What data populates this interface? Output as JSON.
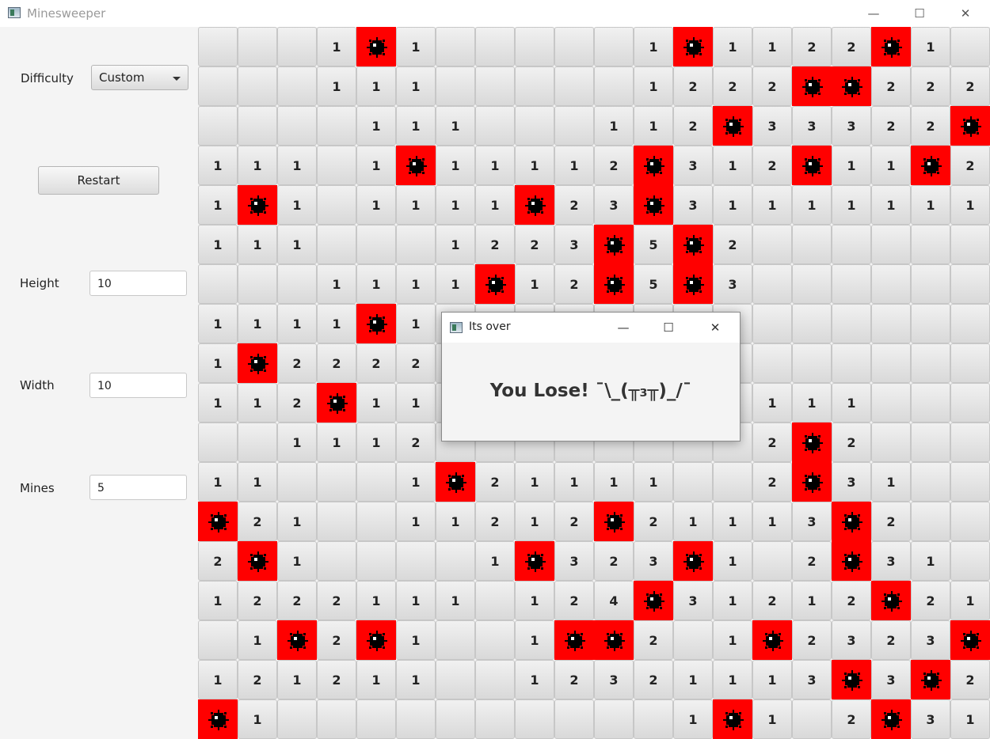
{
  "window": {
    "title": "Minesweeper",
    "minimize_icon": "minimize-icon",
    "maximize_icon": "maximize-icon",
    "close_icon": "close-icon",
    "minimize_glyph": "—",
    "maximize_glyph": "☐",
    "close_glyph": "✕"
  },
  "controls": {
    "difficulty_label": "Difficulty",
    "difficulty_value": "Custom",
    "restart_label": "Restart",
    "height_label": "Height",
    "height_value": "10",
    "width_label": "Width",
    "width_value": "10",
    "mines_label": "Mines",
    "mines_value": "5"
  },
  "board": {
    "mine_color": "#ff0000",
    "rows": [
      "___1M1_____1M1122M1",
      "___111_____1222MM222",
      "____111___112M33322M",
      "111_1M11112M312M11M2",
      "1M1_1111M23M31111111",
      "111___1223M5M2______",
      "___1111M12M5M3______",
      "1111M1______________",
      "1M2222______________",
      "112M11________111___",
      "__1112________2M2___",
      "11___1M21111__2M31__",
      "M21__11212M21113M2__",
      "2M1____1M323M1_2M31_",
      "1222111_124M31212M21",
      "_1M2M1__1MM2_1M2323M",
      "121211__12321113M3M21",
      "M1__________1M1_2M311_"
    ]
  },
  "dialog": {
    "title": "Its over",
    "message": "You Lose! ¯\\_(╥₃╥)_/¯",
    "minimize_glyph": "—",
    "maximize_glyph": "☐",
    "close_glyph": "✕"
  }
}
